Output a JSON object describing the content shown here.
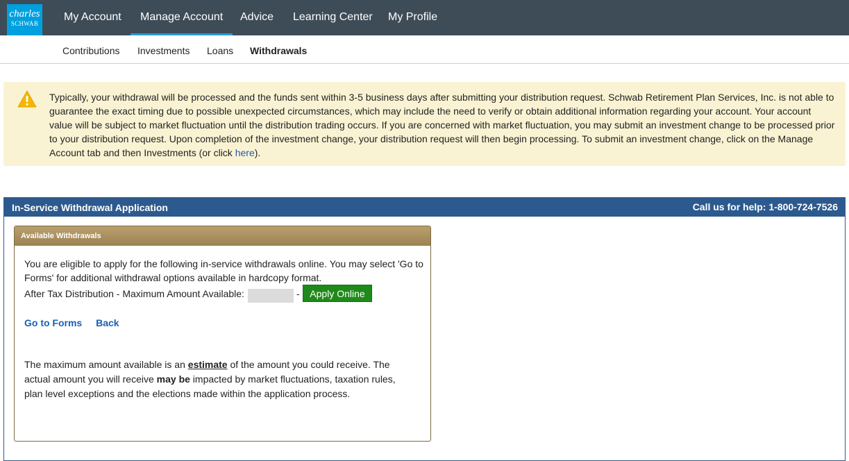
{
  "logo": {
    "line1": "charles",
    "line2": "SCHWAB"
  },
  "nav": {
    "items": [
      {
        "label": "My Account"
      },
      {
        "label": "Manage Account"
      },
      {
        "label": "Advice"
      },
      {
        "label": "Learning Center"
      },
      {
        "label": "My Profile"
      }
    ],
    "active": "Manage Account"
  },
  "subnav": {
    "items": [
      {
        "label": "Contributions"
      },
      {
        "label": "Investments"
      },
      {
        "label": "Loans"
      },
      {
        "label": "Withdrawals"
      }
    ],
    "active": "Withdrawals"
  },
  "notice": {
    "text": "Typically, your withdrawal will be processed and the funds sent within 3-5 business days after submitting your distribution request. Schwab Retirement Plan Services, Inc. is not able to guarantee the exact timing due to possible unexpected circumstances, which may include the need to verify or obtain additional information regarding your account. Your account value will be subject to market fluctuation until the distribution trading occurs. If you are concerned with market fluctuation, you may submit an investment change to be processed prior to your distribution request. Upon completion of the investment change, your distribution request will then begin processing. To submit an investment change, click on the Manage Account tab and then Investments (or click ",
    "link": "here",
    "suffix": ")."
  },
  "panel": {
    "title": "In-Service Withdrawal Application",
    "help": "Call us for help: 1-800-724-7526"
  },
  "card": {
    "title": "Available Withdrawals",
    "intro": "You are eligible to apply for the following in-service withdrawals online. You may select 'Go to Forms' for additional withdrawal options available in hardcopy format.",
    "amount_label": "After Tax Distribution - Maximum Amount Available:",
    "dash": "-",
    "apply_label": "Apply Online",
    "go_to_forms": "Go to Forms",
    "back": "Back",
    "disclaimer": {
      "p1": "The maximum amount available is an ",
      "estimate": "estimate",
      "p2": " of the amount you could receive. The actual amount you will receive ",
      "may_be": "may be",
      "p3": " impacted by market fluctuations, taxation rules, plan level exceptions and the elections made within the application process."
    }
  }
}
